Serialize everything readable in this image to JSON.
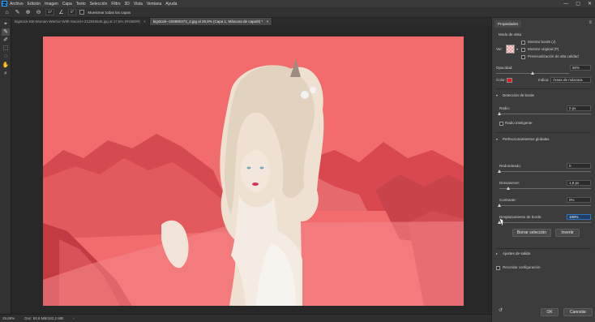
{
  "app": {
    "logo_text": "Ps"
  },
  "menu": [
    "Archivo",
    "Edición",
    "Imagen",
    "Capa",
    "Texto",
    "Selección",
    "Filtro",
    "3D",
    "Vista",
    "Ventana",
    "Ayuda"
  ],
  "window_controls": {
    "minimize": "—",
    "maximize": "▢",
    "close": "✕"
  },
  "options_bar": {
    "size_value": "17",
    "angle_value": "0°",
    "sample_all_layers_label": "Muestrear todas las capas"
  },
  "tabs": [
    {
      "label": "bigstock-EB-Woman-Warrior-With-Sword-I-212848546.jpg al 17,6% (RGB/8#)",
      "active": false
    },
    {
      "label": "bigstock--226880473_2.jpg al 25,9% (Capa 1, Máscara de capa/8) *",
      "active": true
    }
  ],
  "status_bar": {
    "zoom": "25,89%",
    "doc_info": "Doc: 50,6 MB/182,2 MB"
  },
  "panel": {
    "tab_label": "Propiedades",
    "view_mode_label": "Modo de vista",
    "view_label": "Ver:",
    "show_edge": "Mostrar borde (J)",
    "show_original": "Mostrar original (P)",
    "hq_preview": "Previsualización de alta calidad",
    "opacity_label": "Opacidad:",
    "opacity_value": "50%",
    "opacity_level": 0.5,
    "color_label": "Color:",
    "color_hex": "#e8151b",
    "indicates_label": "Indica:",
    "indicates_value": "Áreas de máscara",
    "edge_detection_title": "Detección de borde",
    "radius_label": "Radio:",
    "radius_value": "0 px",
    "radius_level": 0,
    "smart_radius_label": "Radio inteligente",
    "global_refinements_title": "Perfeccionamientos globales",
    "smooth_label": "Redondeado:",
    "smooth_value": "0",
    "smooth_level": 0,
    "feather_label": "Desvanecer:",
    "feather_value": "1,8 px",
    "feather_level": 0.1,
    "contrast_label": "Contraste:",
    "contrast_value": "0%",
    "contrast_level": 0,
    "shift_edge_label": "Desplazamiento de borde:",
    "shift_edge_value": "100%",
    "shift_edge_level": 1.0,
    "clear_selection_btn": "Borrar selección",
    "invert_btn": "Invertir",
    "output_settings_title": "Ajustes de salida",
    "remember_settings_label": "Recordar configuración",
    "ok_btn": "OK",
    "cancel_btn": "Cancelar"
  }
}
